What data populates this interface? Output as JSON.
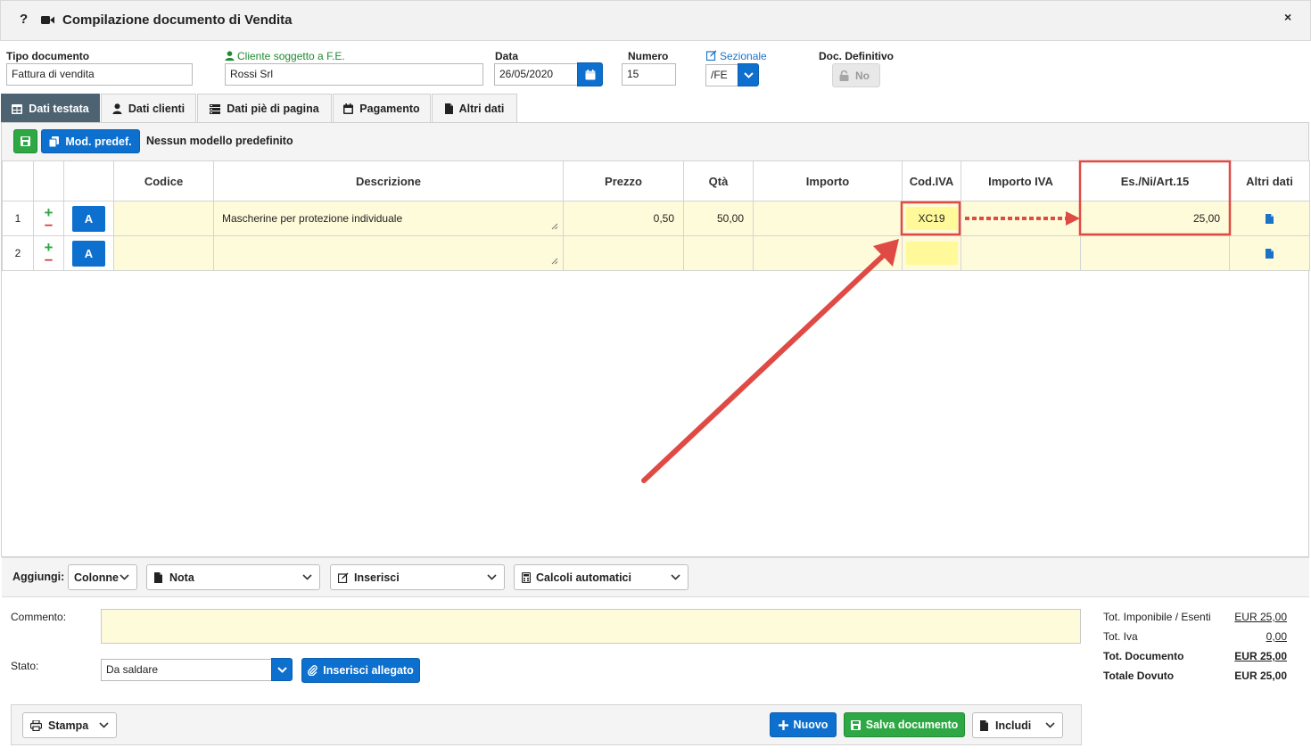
{
  "window": {
    "help_label": "?",
    "title": "Compilazione documento di Vendita",
    "close_label": "×"
  },
  "header": {
    "tipo_documento": {
      "label": "Tipo documento",
      "value": "Fattura di vendita"
    },
    "cliente": {
      "label": "Cliente soggetto a F.E.",
      "value": "Rossi Srl"
    },
    "data": {
      "label": "Data",
      "value": "26/05/2020"
    },
    "numero": {
      "label": "Numero",
      "value": "15"
    },
    "sezionale": {
      "label": "Sezionale",
      "value": "/FE"
    },
    "doc_definitivo": {
      "label": "Doc. Definitivo",
      "value": "No"
    }
  },
  "tabs": [
    {
      "label": "Dati testata",
      "icon": "grid-icon",
      "active": true
    },
    {
      "label": "Dati clienti",
      "icon": "user-icon",
      "active": false
    },
    {
      "label": "Dati piè di pagina",
      "icon": "list-icon",
      "active": false
    },
    {
      "label": "Pagamento",
      "icon": "calendar-icon",
      "active": false
    },
    {
      "label": "Altri dati",
      "icon": "file-icon",
      "active": false
    }
  ],
  "toolbar": {
    "mod_predef_label": "Mod. predef.",
    "model_status": "Nessun modello predefinito"
  },
  "grid": {
    "columns": [
      "",
      "",
      "",
      "Codice",
      "Descrizione",
      "Prezzo",
      "Qtà",
      "Importo",
      "Cod.IVA",
      "Importo IVA",
      "Es./Ni/Art.15",
      "Altri dati"
    ],
    "rows": [
      {
        "num": "1",
        "codice": "",
        "descrizione": "Mascherine per protezione individuale",
        "prezzo": "0,50",
        "qta": "50,00",
        "importo": "",
        "cod_iva": "XC19",
        "importo_iva": "",
        "es_ni_art15": "25,00"
      },
      {
        "num": "2",
        "codice": "",
        "descrizione": "",
        "prezzo": "",
        "qta": "",
        "importo": "",
        "cod_iva": "",
        "importo_iva": "",
        "es_ni_art15": ""
      }
    ],
    "a_button_label": "A",
    "plus": "+",
    "minus": "–"
  },
  "addbar": {
    "label": "Aggiungi:",
    "colonne": "Colonne",
    "nota": "Nota",
    "inserisci": "Inserisci",
    "calcoli": "Calcoli automatici"
  },
  "footer": {
    "commento_label": "Commento:",
    "commento_value": "",
    "stato_label": "Stato:",
    "stato_value": "Da saldare",
    "allegato_label": "Inserisci allegato",
    "totals": [
      {
        "label": "Tot. Imponibile / Esenti",
        "value": "EUR 25,00",
        "bold": false
      },
      {
        "label": "Tot. Iva",
        "value": "0,00",
        "bold": false
      },
      {
        "label": "Tot. Documento",
        "value": "EUR 25,00",
        "bold": true
      },
      {
        "label": "Totale Dovuto",
        "value": "EUR 25,00",
        "bold": true
      }
    ]
  },
  "actions": {
    "stampa": "Stampa",
    "nuovo": "Nuovo",
    "salva": "Salva documento",
    "includi": "Includi"
  },
  "colors": {
    "accent_blue": "#0d6fce",
    "success_green": "#2ea844",
    "annotation_red": "#e04a45",
    "row_yellow": "#fdfbd9",
    "active_tab": "#4e6372"
  }
}
